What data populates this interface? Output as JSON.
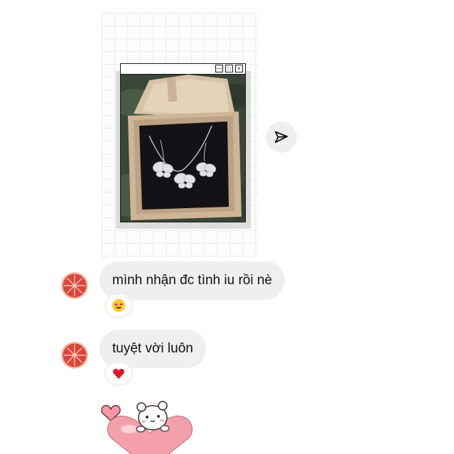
{
  "story": {
    "window_controls": [
      "—",
      "□",
      "×"
    ],
    "photo_icon": "necklace-in-gift-box-photo"
  },
  "share_button": {
    "icon": "send-paper-plane-icon"
  },
  "messages": [
    {
      "text": "mình nhận đc tình iu rồi nè",
      "reaction": "heart-eyes-emoji",
      "avatar": "grapefruit-slice-avatar"
    },
    {
      "text": "tuyệt vời luôn",
      "reaction": "red-heart-emoji",
      "avatar": "grapefruit-slice-avatar"
    }
  ],
  "sticker": {
    "icon": "bear-hugging-heart-sticker"
  },
  "colors": {
    "bubble_bg": "#efefef",
    "avatar_red": "#d64a3c",
    "heart_red": "#e0182d",
    "sticker_pink": "#f4a0aa"
  }
}
